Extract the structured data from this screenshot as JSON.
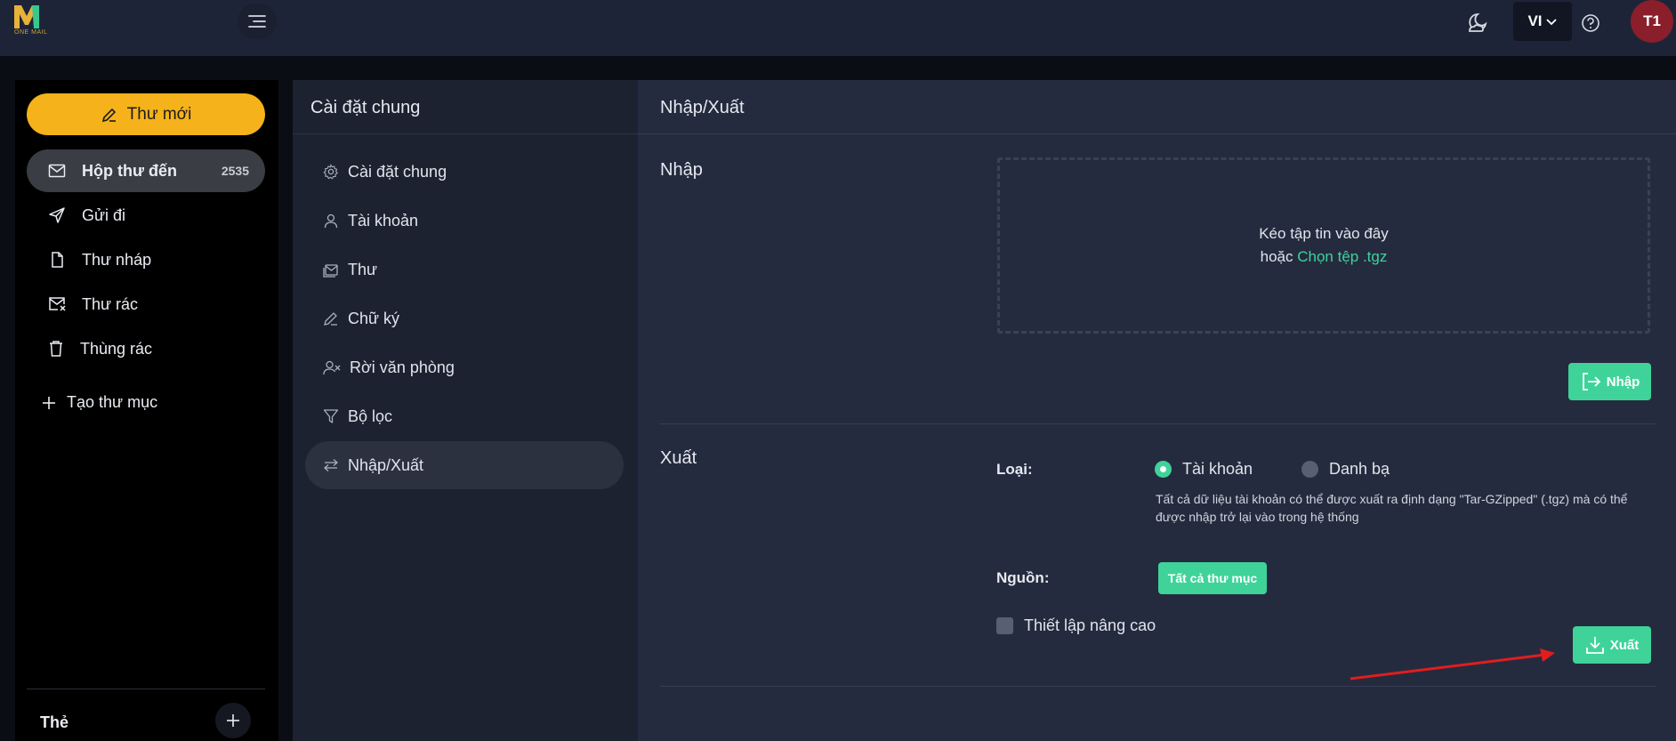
{
  "app": {
    "logo_text": "ONE MAIL"
  },
  "header": {
    "lang": "VI",
    "avatar_initials": "T1"
  },
  "sidebar": {
    "compose_label": "Thư mới",
    "items": [
      {
        "label": "Hộp thư đến",
        "count": "2535",
        "icon": "inbox-icon"
      },
      {
        "label": "Gửi đi",
        "icon": "send-icon"
      },
      {
        "label": "Thư nháp",
        "icon": "draft-icon"
      },
      {
        "label": "Thư rác",
        "icon": "spam-icon"
      },
      {
        "label": "Thùng rác",
        "icon": "trash-icon"
      }
    ],
    "create_folder": "Tạo thư mục",
    "tags_label": "Thẻ"
  },
  "settings": {
    "title": "Cài đặt chung",
    "menu": [
      {
        "label": "Cài đặt chung",
        "icon": "gear-icon"
      },
      {
        "label": "Tài khoản",
        "icon": "user-icon"
      },
      {
        "label": "Thư",
        "icon": "mail-stack-icon"
      },
      {
        "label": "Chữ ký",
        "icon": "pen-icon"
      },
      {
        "label": "Rời văn phòng",
        "icon": "user-x-icon"
      },
      {
        "label": "Bộ lọc",
        "icon": "filter-icon"
      },
      {
        "label": "Nhập/Xuất",
        "icon": "swap-icon"
      }
    ]
  },
  "content": {
    "title": "Nhập/Xuất",
    "import": {
      "section_label": "Nhập",
      "drop_text": "Kéo tập tin vào đây",
      "or_text": "hoặc",
      "choose_link": "Chọn tệp .tgz",
      "button_label": "Nhập"
    },
    "export": {
      "section_label": "Xuất",
      "type_label": "Loại:",
      "option_account": "Tài khoản",
      "option_contacts": "Danh bạ",
      "selected_option": "Tài khoản",
      "description": "Tất cả dữ liệu tài khoản có thể được xuất ra định dạng \"Tar-GZipped\" (.tgz) mà có thể được nhập trở lại vào trong hệ thống",
      "source_label": "Nguồn:",
      "source_button": "Tất cả thư mục",
      "advanced_label": "Thiết lập nâng cao",
      "advanced_checked": false,
      "button_label": "Xuất"
    }
  },
  "colors": {
    "accent_green": "#3fd39a",
    "compose_yellow": "#f6b21a",
    "annotation_red": "#e01e1e"
  }
}
